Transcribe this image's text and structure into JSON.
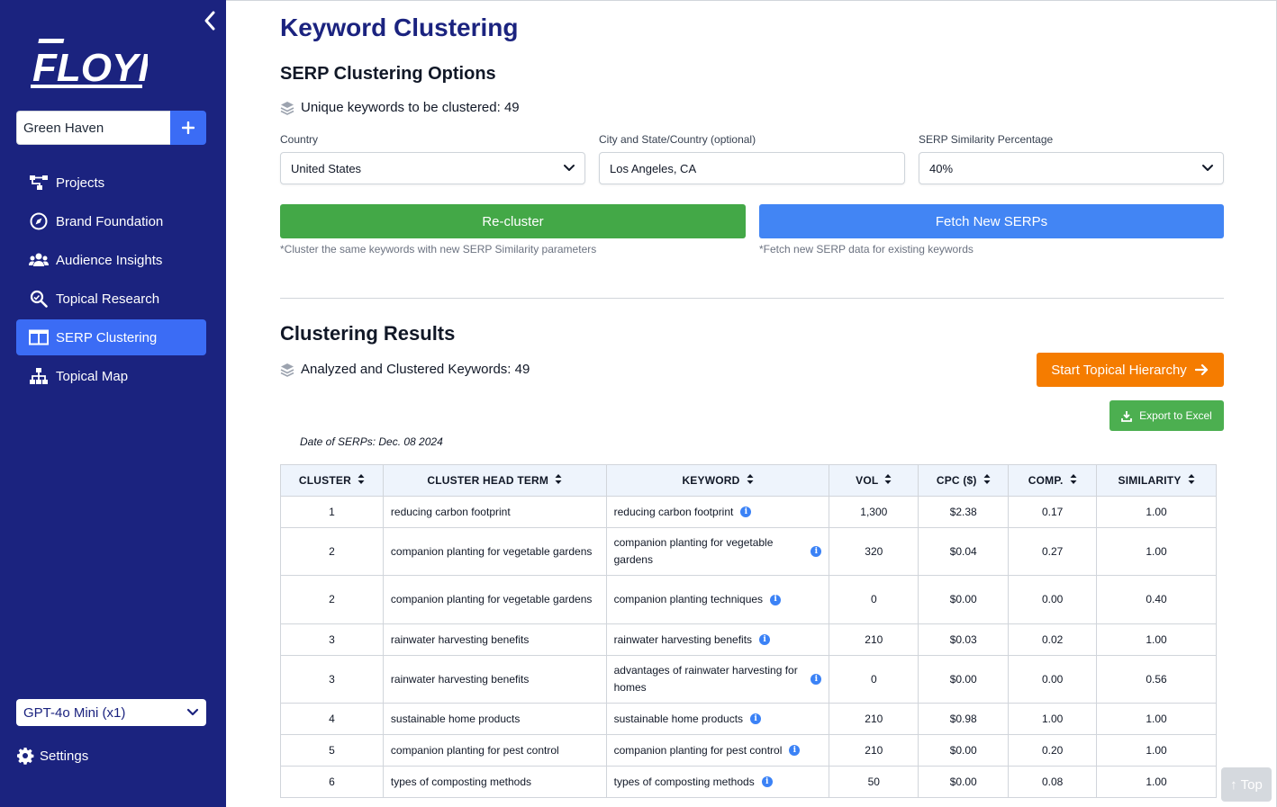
{
  "sidebar": {
    "logo_text": "FLOYI",
    "project_name": "Green Haven",
    "nav": [
      {
        "label": "Projects",
        "icon": "projects-icon"
      },
      {
        "label": "Brand Foundation",
        "icon": "compass-icon"
      },
      {
        "label": "Audience Insights",
        "icon": "users-icon"
      },
      {
        "label": "Topical Research",
        "icon": "search-icon"
      },
      {
        "label": "SERP Clustering",
        "icon": "columns-icon",
        "active": true
      },
      {
        "label": "Topical Map",
        "icon": "sitemap-icon"
      }
    ],
    "model": "GPT-4o Mini (x1)",
    "settings_label": "Settings"
  },
  "main": {
    "title": "Keyword Clustering",
    "options_title": "SERP Clustering Options",
    "unique_keywords": "Unique keywords to be clustered: 49",
    "country": {
      "label": "Country",
      "value": "United States"
    },
    "city": {
      "label": "City and State/Country (optional)",
      "value": "Los Angeles, CA"
    },
    "similarity": {
      "label": "SERP Similarity Percentage",
      "value": "40%"
    },
    "recluster": {
      "label": "Re-cluster",
      "note": "*Cluster the same keywords with new SERP Similarity parameters"
    },
    "fetch": {
      "label": "Fetch New SERPs",
      "note": "*Fetch new SERP data for existing keywords"
    },
    "results_title": "Clustering Results",
    "analyzed": "Analyzed and Clustered Keywords: 49",
    "start_hierarchy": "Start Topical Hierarchy",
    "export": "Export to Excel",
    "date_note": "Date of SERPs: Dec. 08 2024",
    "top_label": "Top"
  },
  "colors": {
    "sidebar": "#1b237f",
    "accent_blue": "#3b6cf5",
    "green": "#43a847",
    "fetch_blue": "#4285f4",
    "orange": "#f57c00"
  },
  "table": {
    "headers": [
      "CLUSTER",
      "CLUSTER HEAD TERM",
      "KEYWORD",
      "VOL",
      "CPC ($)",
      "COMP.",
      "SIMILARITY"
    ],
    "rows": [
      {
        "cluster": "1",
        "head": "reducing carbon footprint",
        "keyword": "reducing carbon footprint",
        "vol": "1,300",
        "cpc": "$2.38",
        "comp": "0.17",
        "sim": "1.00"
      },
      {
        "cluster": "2",
        "head": "companion planting for vegetable gardens",
        "keyword": "companion planting for vegetable gardens",
        "vol": "320",
        "cpc": "$0.04",
        "comp": "0.27",
        "sim": "1.00"
      },
      {
        "cluster": "2",
        "head": "companion planting for vegetable gardens",
        "keyword": "companion planting techniques",
        "vol": "0",
        "cpc": "$0.00",
        "comp": "0.00",
        "sim": "0.40"
      },
      {
        "cluster": "3",
        "head": "rainwater harvesting benefits",
        "keyword": "rainwater harvesting benefits",
        "vol": "210",
        "cpc": "$0.03",
        "comp": "0.02",
        "sim": "1.00"
      },
      {
        "cluster": "3",
        "head": "rainwater harvesting benefits",
        "keyword": "advantages of rainwater harvesting for homes",
        "vol": "0",
        "cpc": "$0.00",
        "comp": "0.00",
        "sim": "0.56"
      },
      {
        "cluster": "4",
        "head": "sustainable home products",
        "keyword": "sustainable home products",
        "vol": "210",
        "cpc": "$0.98",
        "comp": "1.00",
        "sim": "1.00"
      },
      {
        "cluster": "5",
        "head": "companion planting for pest control",
        "keyword": "companion planting for pest control",
        "vol": "210",
        "cpc": "$0.00",
        "comp": "0.20",
        "sim": "1.00"
      },
      {
        "cluster": "6",
        "head": "types of composting methods",
        "keyword": "types of composting methods",
        "vol": "50",
        "cpc": "$0.00",
        "comp": "0.08",
        "sim": "1.00"
      }
    ]
  }
}
